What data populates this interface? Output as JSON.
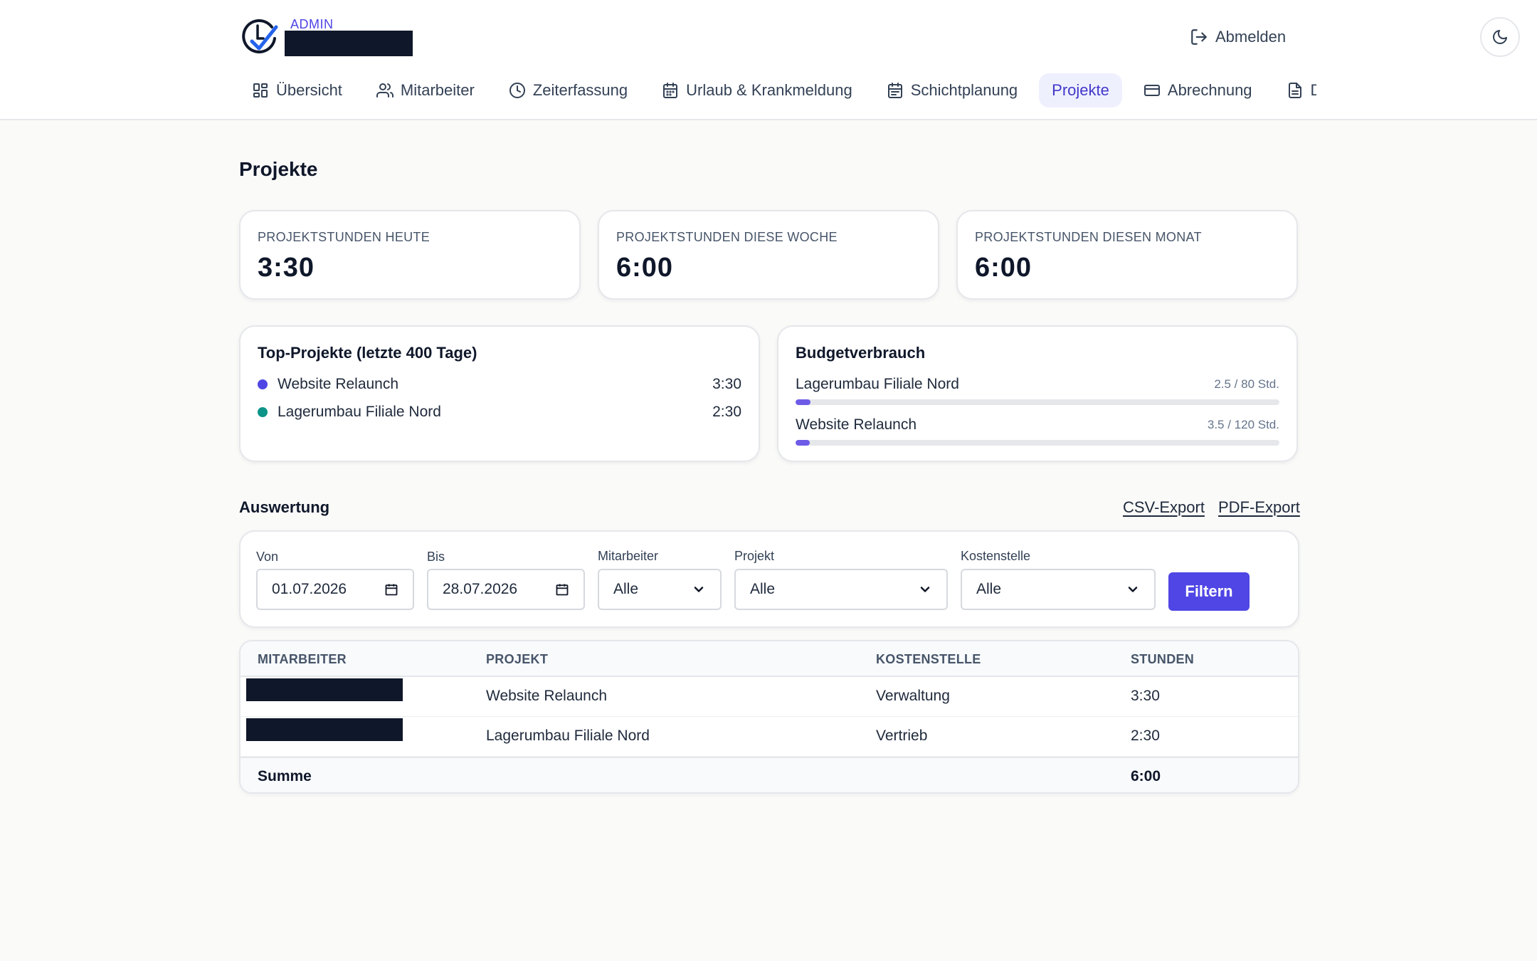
{
  "header": {
    "role": "ADMIN",
    "logout_label": "Abmelden",
    "nav": [
      {
        "label": "Übersicht",
        "icon": "grid-icon"
      },
      {
        "label": "Mitarbeiter",
        "icon": "users-icon"
      },
      {
        "label": "Zeiterfassung",
        "icon": "clock-icon"
      },
      {
        "label": "Urlaub & Krankmeldung",
        "icon": "calendar-icon"
      },
      {
        "label": "Schichtplanung",
        "icon": "calendar-check-icon"
      },
      {
        "label": "Projekte",
        "icon": "",
        "active": true
      },
      {
        "label": "Abrechnung",
        "icon": "credit-card-icon"
      },
      {
        "label": "Dokumente",
        "icon": "document-icon"
      }
    ]
  },
  "page": {
    "title": "Projekte"
  },
  "stats": [
    {
      "label": "PROJEKTSTUNDEN HEUTE",
      "value": "3:30"
    },
    {
      "label": "PROJEKTSTUNDEN DIESE WOCHE",
      "value": "6:00"
    },
    {
      "label": "PROJEKTSTUNDEN DIESEN MONAT",
      "value": "6:00"
    }
  ],
  "top_projects": {
    "title": "Top-Projekte (letzte 400 Tage)",
    "items": [
      {
        "name": "Website Relaunch",
        "value": "3:30",
        "color": "#4f46e5"
      },
      {
        "name": "Lagerumbau Filiale Nord",
        "value": "2:30",
        "color": "#0d9488"
      }
    ]
  },
  "budget": {
    "title": "Budgetverbrauch",
    "items": [
      {
        "name": "Lagerumbau Filiale Nord",
        "meta": "2.5 / 80 Std.",
        "fraction": 0.03125
      },
      {
        "name": "Website Relaunch",
        "meta": "3.5 / 120 Std.",
        "fraction": 0.029
      }
    ]
  },
  "report": {
    "title": "Auswertung",
    "csv_export": "CSV-Export",
    "pdf_export": "PDF-Export",
    "filters": {
      "from_label": "Von",
      "from_value": "01.07.2026",
      "to_label": "Bis",
      "to_value": "28.07.2026",
      "employee_label": "Mitarbeiter",
      "employee_value": "Alle",
      "project_label": "Projekt",
      "project_value": "Alle",
      "cost_center_label": "Kostenstelle",
      "cost_center_value": "Alle",
      "submit_label": "Filtern"
    },
    "table": {
      "columns": [
        "MITARBEITER",
        "PROJEKT",
        "KOSTENSTELLE",
        "STUNDEN"
      ],
      "rows": [
        {
          "project": "Website Relaunch",
          "cost_center": "Verwaltung",
          "hours": "3:30"
        },
        {
          "project": "Lagerumbau Filiale Nord",
          "cost_center": "Vertrieb",
          "hours": "2:30"
        }
      ],
      "sum_label": "Summe",
      "sum_value": "6:00"
    }
  }
}
